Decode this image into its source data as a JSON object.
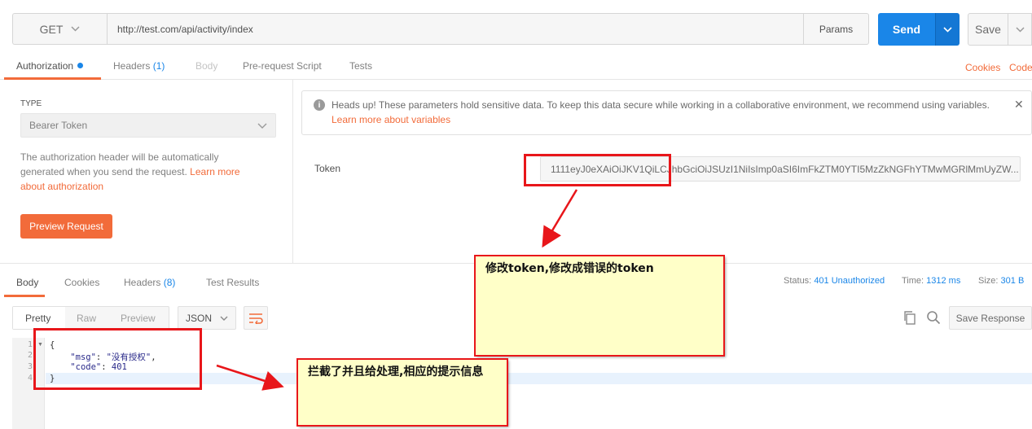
{
  "request": {
    "method": "GET",
    "url": "http://test.com/api/activity/index",
    "params_label": "Params",
    "send_label": "Send",
    "save_label": "Save"
  },
  "request_tabs": {
    "authorization": "Authorization",
    "headers": "Headers",
    "headers_count": "(1)",
    "body": "Body",
    "pre_request": "Pre-request Script",
    "tests": "Tests",
    "cookies": "Cookies",
    "code": "Code"
  },
  "auth": {
    "type_label": "TYPE",
    "type_value": "Bearer Token",
    "desc": "The authorization header will be automatically generated when you send the request.",
    "learn_more": "Learn more about authorization",
    "preview_label": "Preview Request",
    "notice": "Heads up! These parameters hold sensitive data. To keep this data secure while working in a collaborative environment, we recommend using variables.",
    "notice_link": "Learn more about variables",
    "token_label": "Token",
    "token_value": "1111eyJ0eXAiOiJKV1QiLCJhbGciOiJSUzI1NiIsImp0aSI6ImFkZTM0YTI5MzZkNGFhYTMwMGRlMmUyZW..."
  },
  "response_tabs": {
    "body": "Body",
    "cookies": "Cookies",
    "headers": "Headers",
    "headers_count": "(8)",
    "test_results": "Test Results"
  },
  "status": {
    "status_label": "Status:",
    "status_value": "401 Unauthorized",
    "time_label": "Time:",
    "time_value": "1312 ms",
    "size_label": "Size:",
    "size_value": "301 B"
  },
  "view": {
    "pretty": "Pretty",
    "raw": "Raw",
    "preview": "Preview",
    "format": "JSON",
    "save_response": "Save Response"
  },
  "code_lines": {
    "n1": "1",
    "n2": "2",
    "n3": "3",
    "n4": "4",
    "l1": "{",
    "l2_key": "\"msg\"",
    "l2_val": "\"没有授权\"",
    "l3_key": "\"code\"",
    "l3_val": "401",
    "l4": "}"
  },
  "annotations": {
    "note1": "修改token,修改成错误的token",
    "note2": "拦截了并且给处理,相应的提示信息"
  },
  "colors": {
    "accent": "#1a86e8",
    "orange": "#f26b3a",
    "annotation_red": "#e8161a",
    "note_bg": "#ffffc8"
  }
}
